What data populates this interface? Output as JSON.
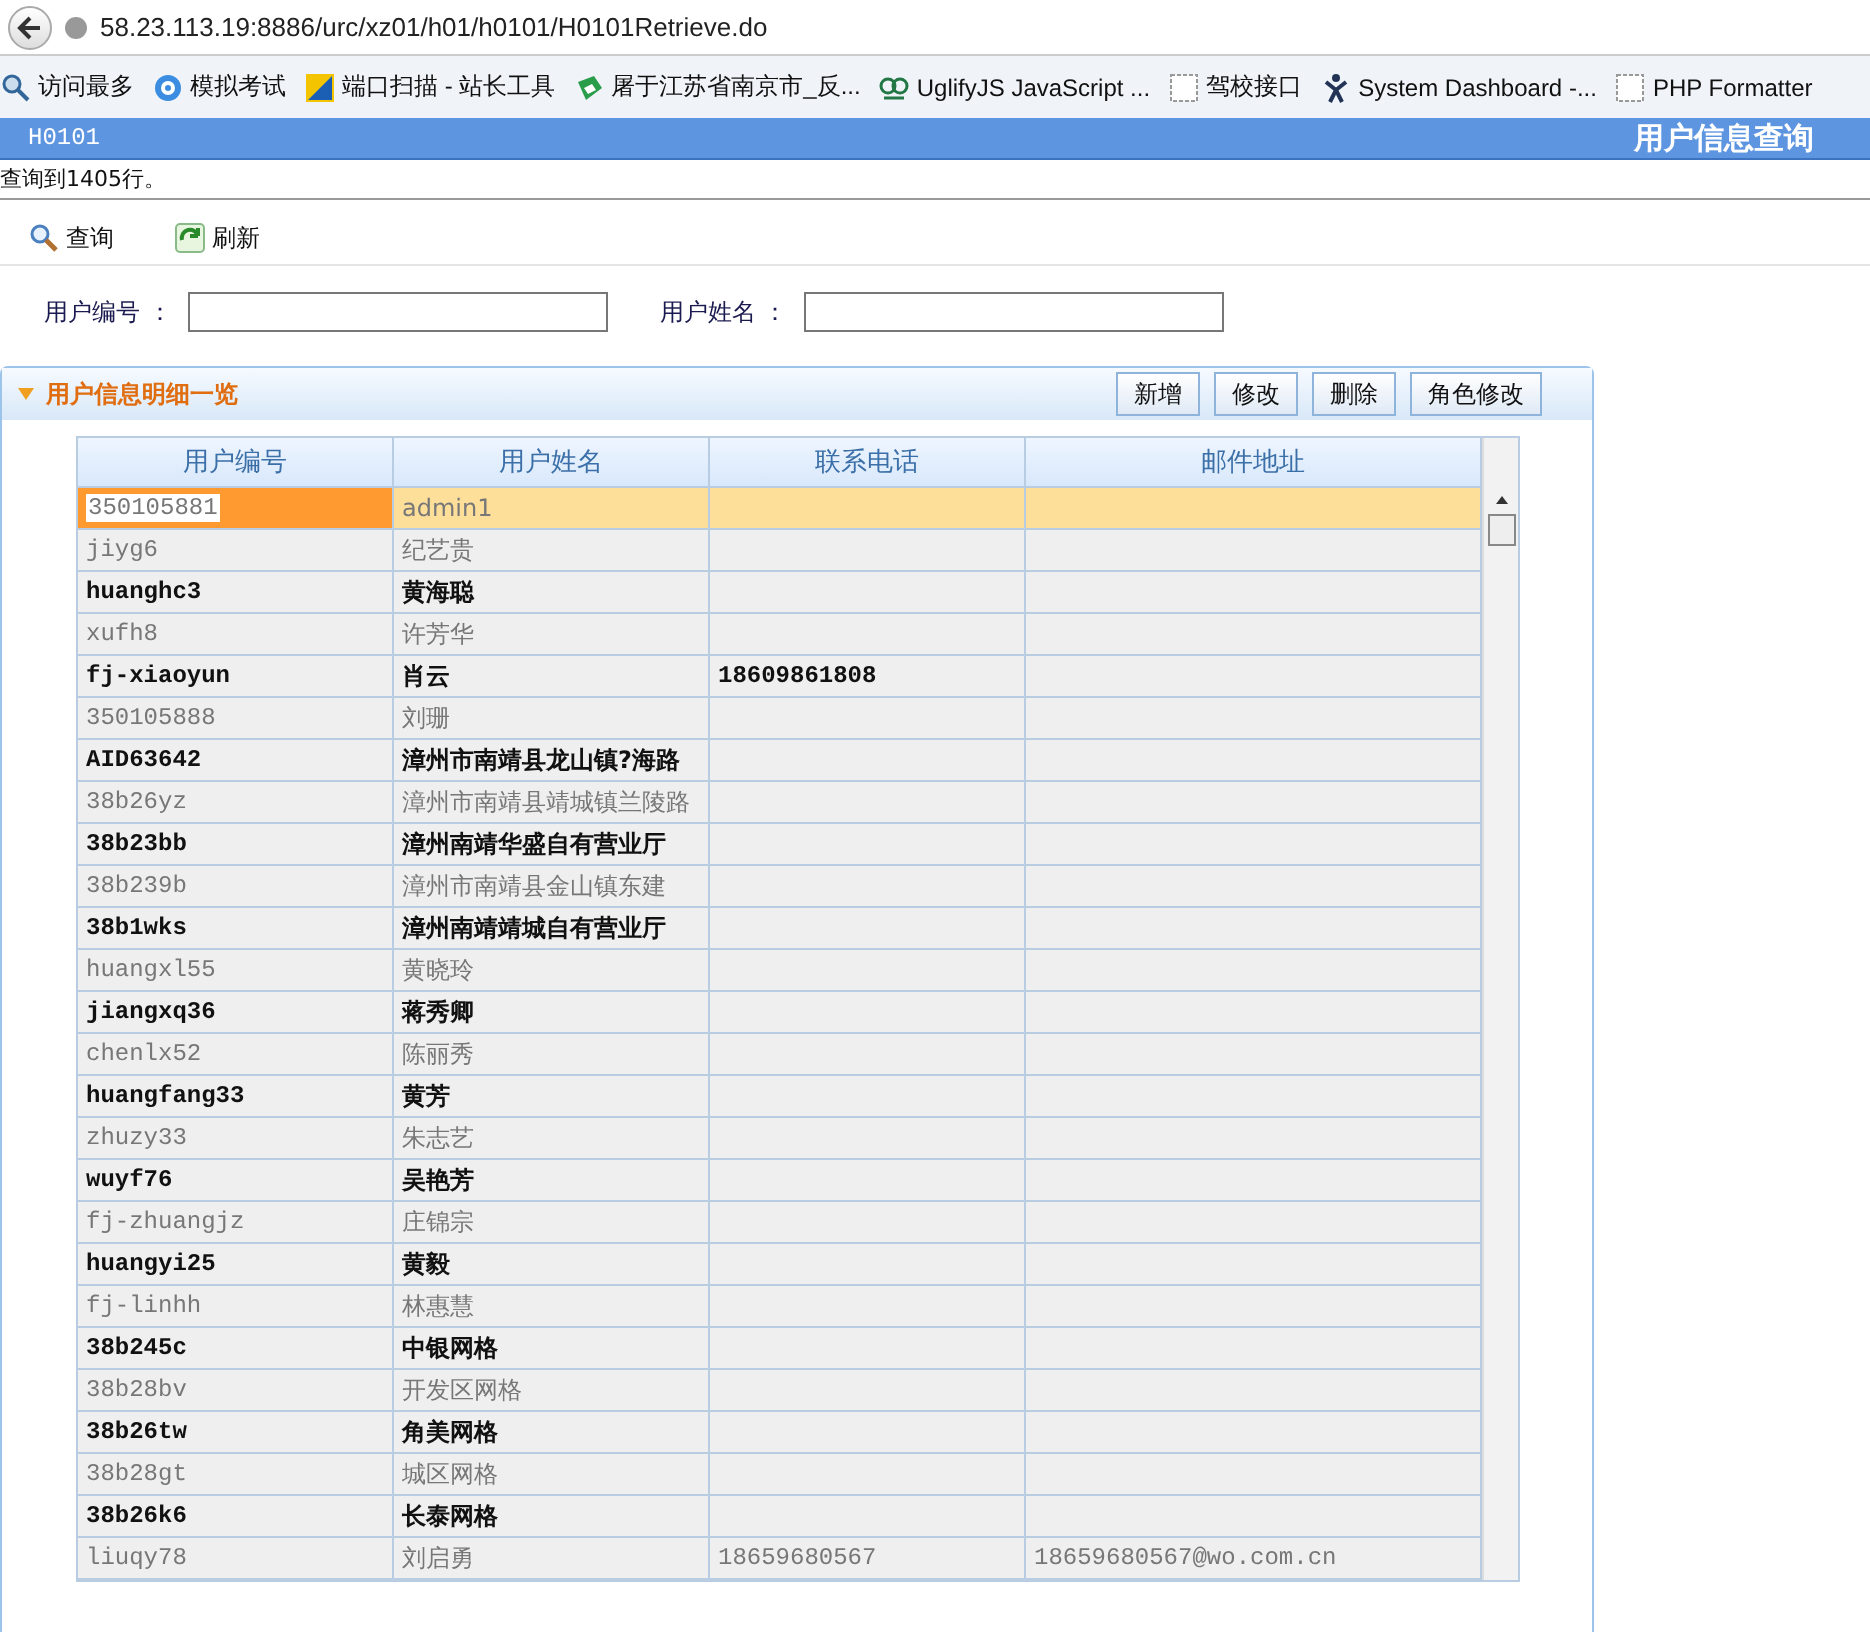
{
  "browser": {
    "url": "58.23.113.19:8886/urc/xz01/h01/h0101/H0101Retrieve.do",
    "bookmarks": [
      {
        "label": "访问最多",
        "kind": "search"
      },
      {
        "label": "模拟考试",
        "kind": "wheel"
      },
      {
        "label": "端口扫描 - 站长工具",
        "kind": "chart"
      },
      {
        "label": "屠于江苏省南京市_反...",
        "kind": "arrows"
      },
      {
        "label": "UglifyJS JavaScript ...",
        "kind": "owl"
      },
      {
        "label": "驾校接口",
        "kind": "blank"
      },
      {
        "label": "System Dashboard -...",
        "kind": "figure"
      },
      {
        "label": "PHP Formatter",
        "kind": "blank"
      }
    ]
  },
  "header": {
    "code": "H0101",
    "title": "用户信息查询"
  },
  "status": "查询到1405行。",
  "toolbar": [
    {
      "label": "查询",
      "kind": "search"
    },
    {
      "label": "刷新",
      "kind": "refresh"
    }
  ],
  "form": [
    {
      "label": "用户编号 ："
    },
    {
      "label": "用户姓名 ："
    }
  ],
  "panel": {
    "title": "用户信息明细一览",
    "buttons": [
      "新增",
      "修改",
      "删除",
      "角色修改"
    ]
  },
  "table": {
    "columns": [
      "用户编号",
      "用户姓名",
      "联系电话",
      "邮件地址"
    ],
    "rows": [
      {
        "cells": [
          "350105881",
          "admin1",
          "",
          ""
        ],
        "selected": true
      },
      {
        "cells": [
          "jiyg6",
          "纪艺贵",
          "",
          ""
        ],
        "selected": false
      },
      {
        "cells": [
          "huanghc3",
          "黄海聪",
          "",
          ""
        ],
        "selected": false
      },
      {
        "cells": [
          "xufh8",
          "许芳华",
          "",
          ""
        ],
        "selected": false
      },
      {
        "cells": [
          "fj-xiaoyun",
          "肖云",
          "18609861808",
          ""
        ],
        "selected": false
      },
      {
        "cells": [
          "350105888",
          "刘珊",
          "",
          ""
        ],
        "selected": false
      },
      {
        "cells": [
          "AID63642",
          "漳州市南靖县龙山镇?海路",
          "",
          ""
        ],
        "selected": false
      },
      {
        "cells": [
          "38b26yz",
          "漳州市南靖县靖城镇兰陵路",
          "",
          ""
        ],
        "selected": false
      },
      {
        "cells": [
          "38b23bb",
          "漳州南靖华盛自有营业厅",
          "",
          ""
        ],
        "selected": false
      },
      {
        "cells": [
          "38b239b",
          "漳州市南靖县金山镇东建",
          "",
          ""
        ],
        "selected": false
      },
      {
        "cells": [
          "38b1wks",
          "漳州南靖靖城自有营业厅",
          "",
          ""
        ],
        "selected": false
      },
      {
        "cells": [
          "huangxl55",
          "黄晓玲",
          "",
          ""
        ],
        "selected": false
      },
      {
        "cells": [
          "jiangxq36",
          "蒋秀卿",
          "",
          ""
        ],
        "selected": false
      },
      {
        "cells": [
          "chenlx52",
          "陈丽秀",
          "",
          ""
        ],
        "selected": false
      },
      {
        "cells": [
          "huangfang33",
          "黄芳",
          "",
          ""
        ],
        "selected": false
      },
      {
        "cells": [
          "zhuzy33",
          "朱志艺",
          "",
          ""
        ],
        "selected": false
      },
      {
        "cells": [
          "wuyf76",
          "吴艳芳",
          "",
          ""
        ],
        "selected": false
      },
      {
        "cells": [
          "fj-zhuangjz",
          "庄锦宗",
          "",
          ""
        ],
        "selected": false
      },
      {
        "cells": [
          "huangyi25",
          "黄毅",
          "",
          ""
        ],
        "selected": false
      },
      {
        "cells": [
          "fj-linhh",
          "林惠慧",
          "",
          ""
        ],
        "selected": false
      },
      {
        "cells": [
          "38b245c",
          "中银网格",
          "",
          ""
        ],
        "selected": false
      },
      {
        "cells": [
          "38b28bv",
          "开发区网格",
          "",
          ""
        ],
        "selected": false
      },
      {
        "cells": [
          "38b26tw",
          "角美网格",
          "",
          ""
        ],
        "selected": false
      },
      {
        "cells": [
          "38b28gt",
          "城区网格",
          "",
          ""
        ],
        "selected": false
      },
      {
        "cells": [
          "38b26k6",
          "长泰网格",
          "",
          ""
        ],
        "selected": false
      },
      {
        "cells": [
          "liuqy78",
          "刘启勇",
          "18659680567",
          "18659680567@wo.com.cn"
        ],
        "selected": false
      }
    ]
  }
}
